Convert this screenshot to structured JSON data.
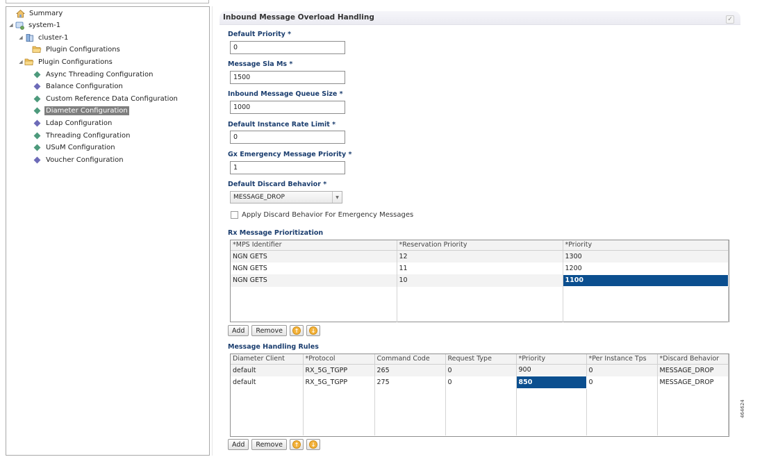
{
  "tree": {
    "items": [
      {
        "label": "Summary",
        "icon": "home-icon"
      },
      {
        "label": "system-1",
        "icon": "system-icon"
      },
      {
        "label": "cluster-1",
        "icon": "cluster-icon"
      },
      {
        "label": "Plugin Configurations",
        "icon": "folder-icon"
      },
      {
        "label": "Plugin Configurations",
        "icon": "folder-icon"
      },
      {
        "label": "Async Threading Configuration",
        "icon": "green-diamond-icon"
      },
      {
        "label": "Balance Configuration",
        "icon": "purple-diamond-icon"
      },
      {
        "label": "Custom Reference Data Configuration",
        "icon": "green-diamond-icon"
      },
      {
        "label": "Diameter Configuration",
        "icon": "green-diamond-icon"
      },
      {
        "label": "Ldap Configuration",
        "icon": "purple-diamond-icon"
      },
      {
        "label": "Threading Configuration",
        "icon": "green-diamond-icon"
      },
      {
        "label": "USuM Configuration",
        "icon": "green-diamond-icon"
      },
      {
        "label": "Voucher Configuration",
        "icon": "purple-diamond-icon"
      }
    ],
    "selected": "Diameter Configuration"
  },
  "section": {
    "title": "Inbound Message Overload Handling",
    "collapse_glyph": "✓"
  },
  "form": {
    "default_priority": {
      "label": "Default Priority *",
      "value": "0"
    },
    "message_sla_ms": {
      "label": "Message Sla Ms *",
      "value": "1500"
    },
    "inbound_queue_size": {
      "label": "Inbound Message Queue Size *",
      "value": "1000"
    },
    "default_instance_rate_limit": {
      "label": "Default Instance Rate Limit *",
      "value": "0"
    },
    "gx_emergency_priority": {
      "label": "Gx Emergency Message Priority *",
      "value": "1"
    },
    "default_discard_behavior": {
      "label": "Default Discard Behavior *",
      "value": "MESSAGE_DROP"
    },
    "apply_discard_emergency": {
      "label": "Apply Discard Behavior For Emergency Messages",
      "checked": false
    }
  },
  "rx_table": {
    "title": "Rx Message Prioritization",
    "columns": [
      "*MPS Identifier",
      "*Reservation Priority",
      "*Priority"
    ],
    "rows": [
      [
        "NGN GETS",
        "12",
        "1300"
      ],
      [
        "NGN GETS",
        "11",
        "1200"
      ],
      [
        "NGN GETS",
        "10",
        "1100"
      ]
    ]
  },
  "rules_table": {
    "title": "Message Handling Rules",
    "columns": [
      "Diameter Client",
      "*Protocol",
      "Command Code",
      "Request Type",
      "*Priority",
      "*Per Instance Tps",
      "*Discard Behavior"
    ],
    "rows": [
      [
        "default",
        "RX_5G_TGPP",
        "265",
        "0",
        "900",
        "0",
        "MESSAGE_DROP"
      ],
      [
        "default",
        "RX_5G_TGPP",
        "275",
        "0",
        "850",
        "0",
        "MESSAGE_DROP"
      ]
    ]
  },
  "buttons": {
    "add": "Add",
    "remove": "Remove"
  },
  "figure_id": "464624"
}
